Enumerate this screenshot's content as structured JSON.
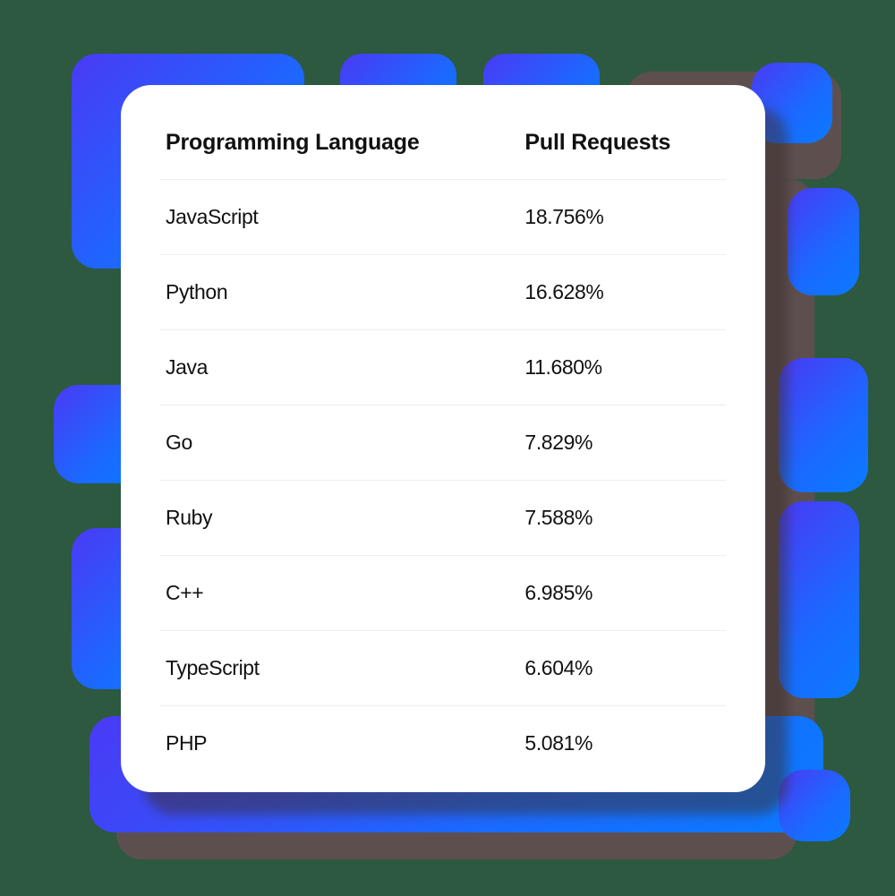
{
  "table": {
    "headers": [
      "Programming Language",
      "Pull Requests"
    ],
    "rows": [
      {
        "language": "JavaScript",
        "pull_requests": "18.756%"
      },
      {
        "language": "Python",
        "pull_requests": "16.628%"
      },
      {
        "language": "Java",
        "pull_requests": "11.680%"
      },
      {
        "language": "Go",
        "pull_requests": "7.829%"
      },
      {
        "language": "Ruby",
        "pull_requests": "7.588%"
      },
      {
        "language": "C++",
        "pull_requests": "6.985%"
      },
      {
        "language": "TypeScript",
        "pull_requests": "6.604%"
      },
      {
        "language": "PHP",
        "pull_requests": "5.081%"
      }
    ]
  },
  "chart_data": {
    "type": "table",
    "title": "",
    "columns": [
      "Programming Language",
      "Pull Requests"
    ],
    "categories": [
      "JavaScript",
      "Python",
      "Java",
      "Go",
      "Ruby",
      "C++",
      "TypeScript",
      "PHP"
    ],
    "values": [
      18.756,
      16.628,
      11.68,
      7.829,
      7.588,
      6.985,
      6.604,
      5.081
    ],
    "unit": "%"
  }
}
